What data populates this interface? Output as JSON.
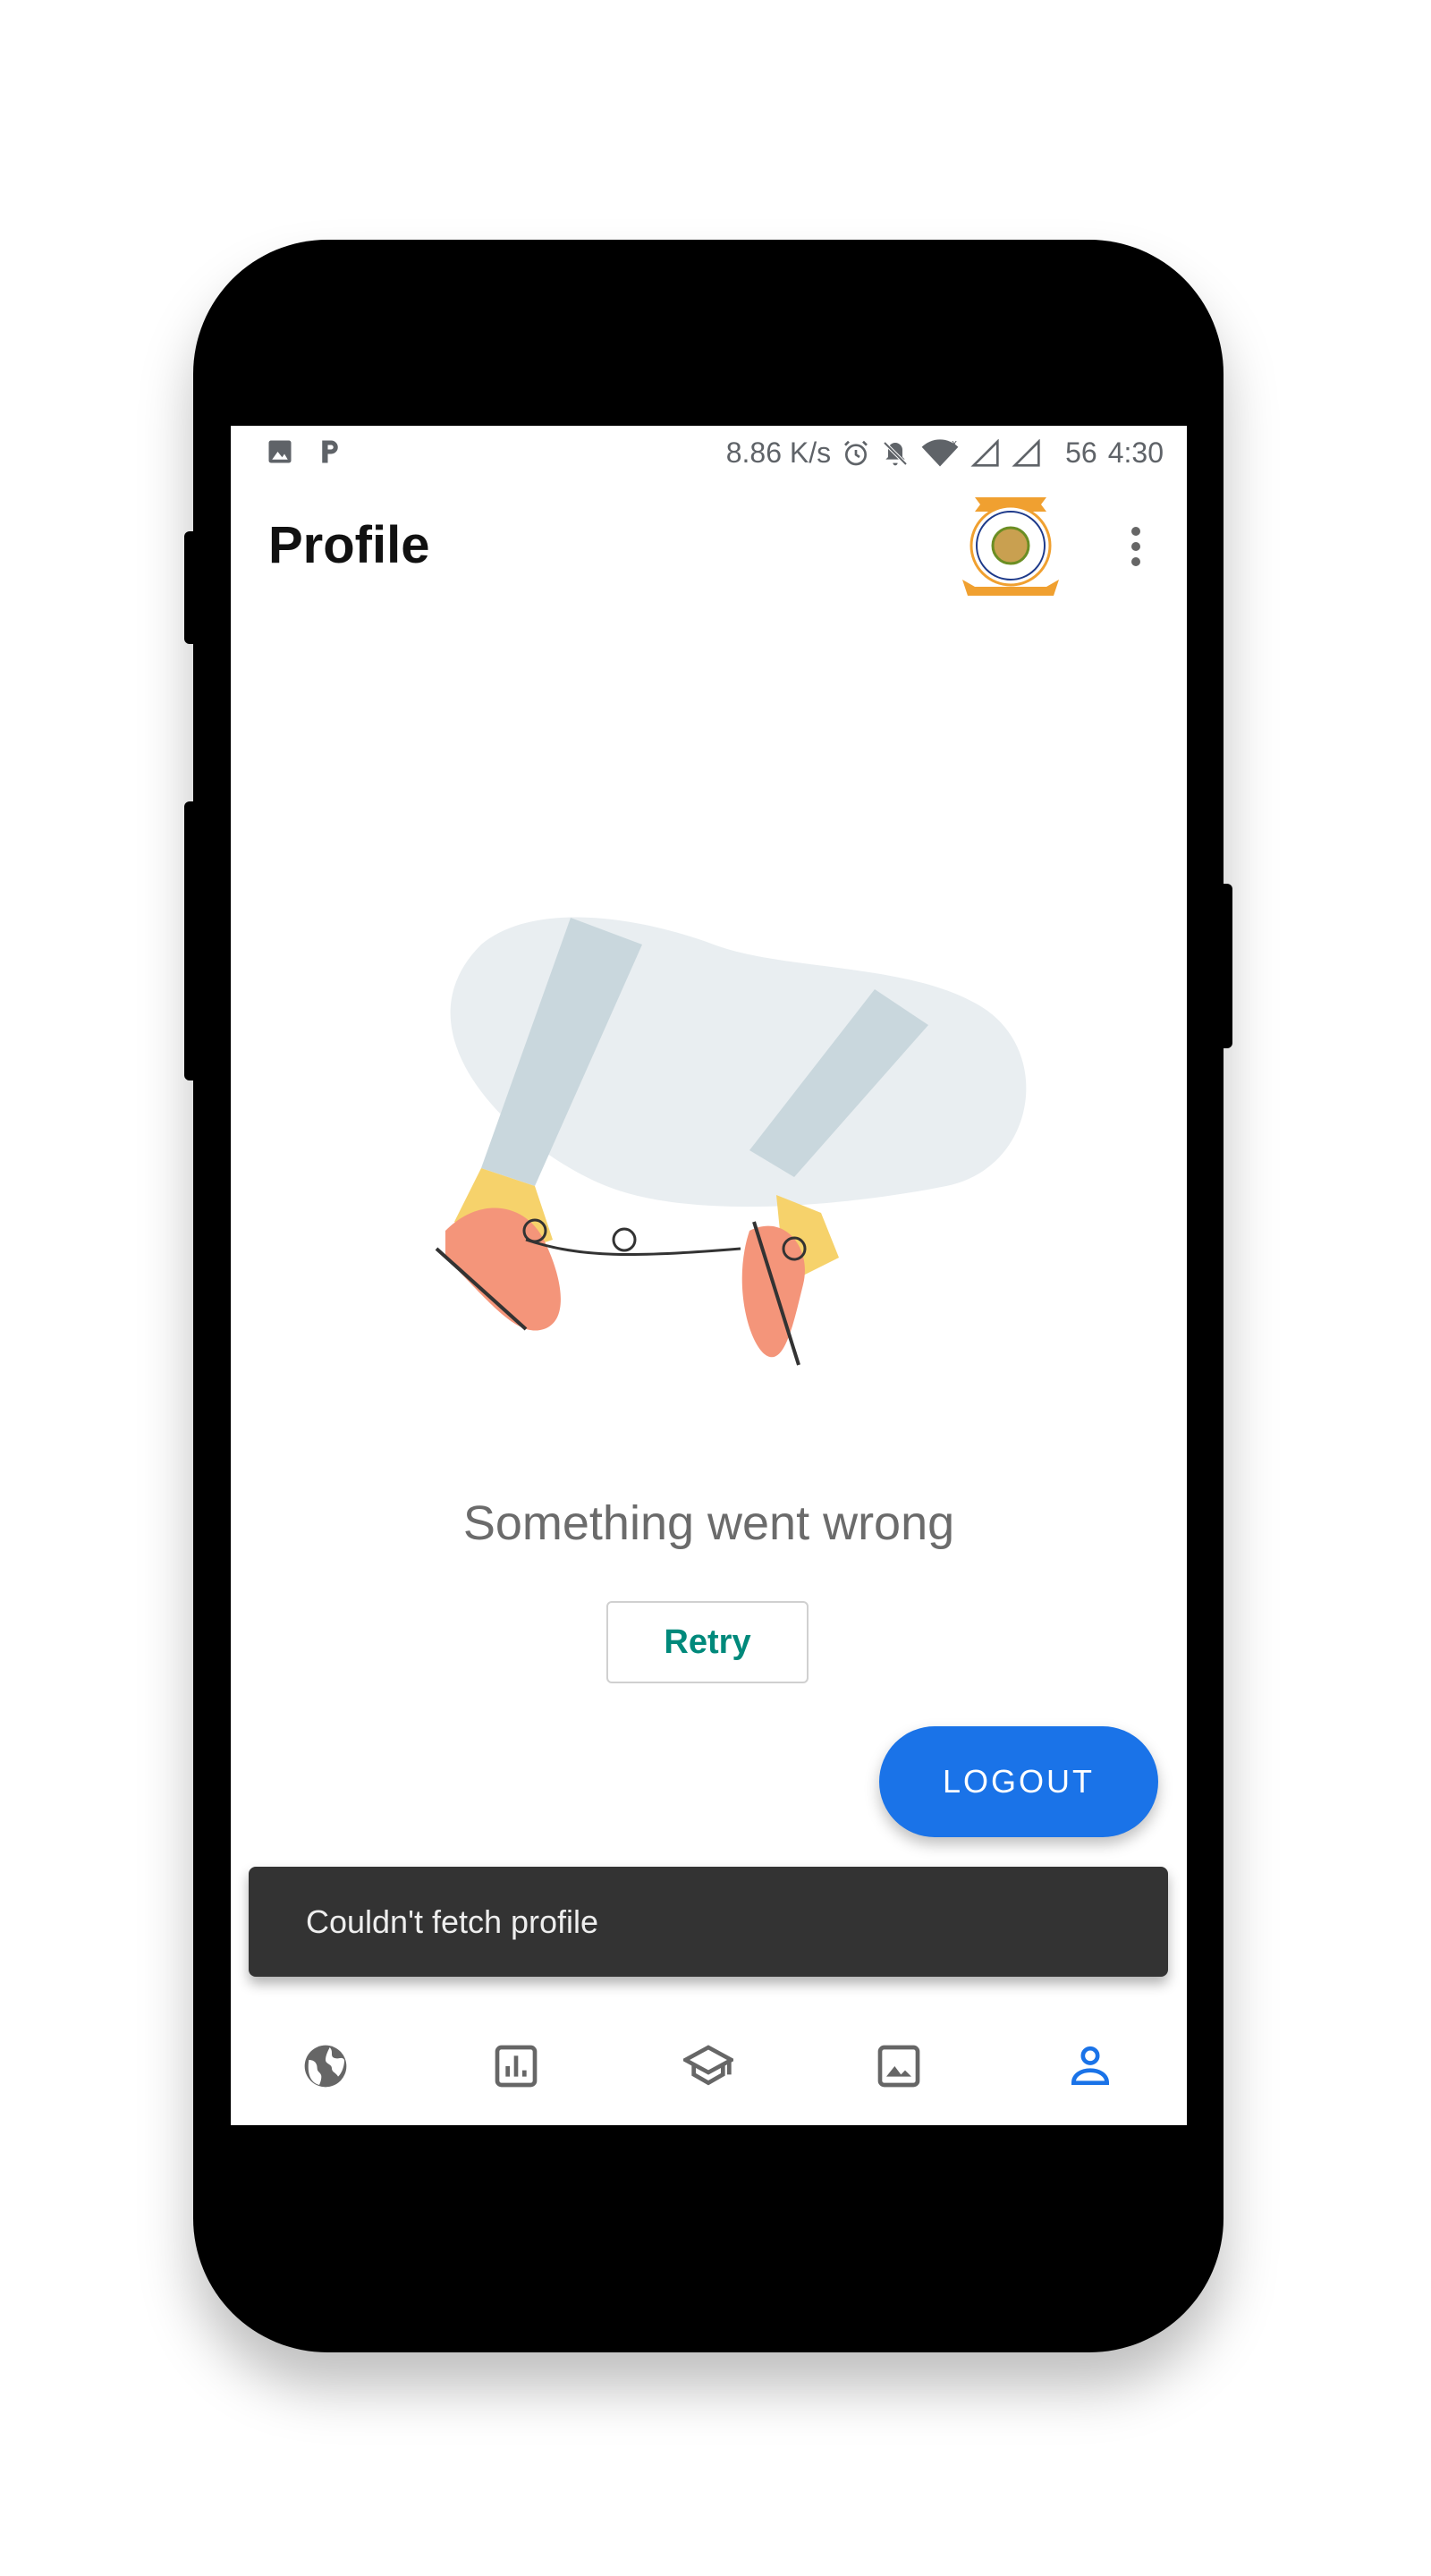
{
  "status_bar": {
    "left_icons": [
      "image-icon",
      "p-icon"
    ],
    "speed": "8.86 K/s",
    "right_icons": [
      "alarm-icon",
      "bell-off-icon",
      "wifi-icon",
      "signal-icon",
      "signal-icon"
    ],
    "battery": "56",
    "time": "4:30"
  },
  "app_bar": {
    "title": "Profile",
    "logo": {
      "top_text": "ESTD. 2001",
      "ring_text": "CANARA ENGINEERING COLLEGE",
      "bottom_text": "IN PURSUIT OF PERFECTION"
    },
    "menu_icon": "more-vert-icon"
  },
  "main": {
    "message": "Something went wrong",
    "retry_label": "Retry",
    "logout_label": "LOGOUT"
  },
  "snackbar": {
    "text": "Couldn't fetch profile"
  },
  "bottom_nav": {
    "items": [
      {
        "icon": "globe-icon",
        "active": false
      },
      {
        "icon": "bar-chart-icon",
        "active": false
      },
      {
        "icon": "school-icon",
        "active": false
      },
      {
        "icon": "image-icon",
        "active": false
      },
      {
        "icon": "person-icon",
        "active": true
      }
    ],
    "active_color": "#1a73e8",
    "inactive_color": "#666666"
  },
  "colors": {
    "accent": "#1a73e8",
    "retry_text": "#00897b",
    "snackbar_bg": "#333333"
  }
}
